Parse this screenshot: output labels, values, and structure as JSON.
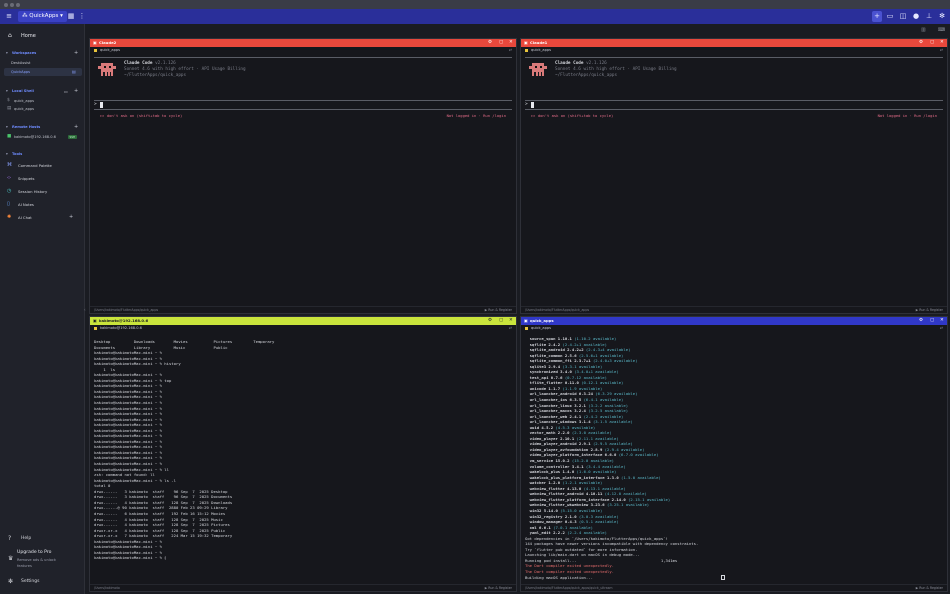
{
  "topbar": {
    "workspace_label": "QuickApps",
    "menu_icon": "hamburger-icon"
  },
  "sidebar": {
    "home_label": "Home",
    "workspaces_label": "Workspaces",
    "workspaces": [
      "DeskAssist",
      "QuickApps"
    ],
    "local_shell_label": "Local Shell",
    "local_shell": [
      "quick_apps",
      "quick_apps"
    ],
    "remote_hosts_label": "Remote Hosts",
    "remote_host": "kakimoto@192.168.0.6",
    "remote_badge": "SSH",
    "tools_label": "Tools",
    "tools": [
      "Command Palette",
      "Snippets",
      "Session History",
      "AI Notes",
      "AI Chat"
    ],
    "help_label": "Help",
    "upgrade_title": "Upgrade to Pro",
    "upgrade_sub1": "Remove ads & unlock",
    "upgrade_sub2": "features",
    "settings_label": "Settings"
  },
  "panes": {
    "tl": {
      "title": "Claude2",
      "chip": "quick_apps",
      "cc_title": "Claude Code",
      "cc_version": "v2.1.126",
      "cc_model": "Sonnet 4.6 with high effort · API Usage Billing",
      "cc_path": "~/FlutterApps/quick_apps",
      "prompt_char": ">",
      "hint": "▸▸ don't ask on (shift+tab to cycle)",
      "login": "Not logged in · Run /login",
      "footer_path": "/Users/kakimoto/FlutterApps/quick_apps",
      "footer_action": "▶ Run & Register"
    },
    "tr": {
      "title": "Claude1",
      "chip": "quick_apps",
      "cc_title": "Claude Code",
      "cc_version": "v2.1.126",
      "cc_model": "Sonnet 4.6 with high effort · API Usage Billing",
      "cc_path": "~/FlutterApps/quick_apps",
      "prompt_char": ">",
      "hint": "▸▸ don't ask on (shift+tab to cycle)",
      "login": "Not logged in · Run /login",
      "footer_path": "/Users/kakimoto/FlutterApps/quick_apps",
      "footer_action": "▶ Run & Register"
    },
    "bl": {
      "title": "kakimoto@192.168.0.6",
      "chip": "kakimoto@192.168.0.6",
      "footer_path": "/Users/kakimoto",
      "footer_action": "▶ Run & Register",
      "lines": [
        "Desktop          Downloads        Movies           Pictures         Temporary",
        "Documents        Library          Music            Public",
        "kakimoto@kakimotoMac-mini ~ %",
        "kakimoto@kakimotoMac-mini ~ %",
        "kakimoto@kakimotoMac-mini ~ % history",
        "    1  ls",
        "kakimoto@kakimotoMac-mini ~ %",
        "kakimoto@kakimotoMac-mini ~ % top",
        "kakimoto@kakimotoMac-mini ~ %",
        "kakimoto@kakimotoMac-mini ~ %",
        "kakimoto@kakimotoMac-mini ~ %",
        "kakimoto@kakimotoMac-mini ~ %",
        "kakimoto@kakimotoMac-mini ~ %",
        "kakimoto@kakimotoMac-mini ~ %",
        "kakimoto@kakimotoMac-mini ~ %",
        "kakimoto@kakimotoMac-mini ~ %",
        "kakimoto@kakimotoMac-mini ~ %",
        "kakimoto@kakimotoMac-mini ~ %",
        "kakimoto@kakimotoMac-mini ~ %",
        "kakimoto@kakimotoMac-mini ~ %",
        "kakimoto@kakimotoMac-mini ~ %",
        "kakimoto@kakimotoMac-mini ~ %",
        "kakimoto@kakimotoMac-mini ~ %",
        "kakimoto@kakimotoMac-mini ~ % ll",
        "zsh: command not found: ll",
        "kakimoto@kakimotoMac-mini ~ % ls -l",
        "total 0",
        "drwx------   3 kakimoto  staff    96 Sep  7  2025 Desktop",
        "drwx------   3 kakimoto  staff    96 Sep  7  2025 Documents",
        "drwx------   4 kakimoto  staff   128 Sep  7  2025 Downloads",
        "drwx------@ 90 kakimoto  staff  2880 Feb 23 09:29 Library",
        "drwx------   6 kakimoto  staff   192 Feb 16 15:12 Movies",
        "drwx------   4 kakimoto  staff   128 Sep  7  2025 Music",
        "drwx------   4 kakimoto  staff   128 Sep  7  2025 Pictures",
        "drwxr-xr-x   4 kakimoto  staff   128 Sep  7  2025 Public",
        "drwxr-xr-x   7 kakimoto  staff   224 Mar 15 19:32 Temporary",
        "kakimoto@kakimotoMac-mini ~ %",
        "kakimoto@kakimotoMac-mini ~ %",
        "kakimoto@kakimotoMac-mini ~ %",
        "kakimoto@kakimotoMac-mini ~ % ▯"
      ]
    },
    "br": {
      "title": "quick_apps",
      "chip": "quick_apps",
      "footer_path": "/Users/kakimoto/FlutterApps/quick_apps/quick_ultrasm",
      "footer_action": "▶ Run & Register",
      "packages": [
        [
          "source_span",
          "1.10.1",
          "(1.10.2 available)"
        ],
        [
          "sqflite",
          "2.4.2",
          "(2.4.2+1 available)"
        ],
        [
          "sqflite_android",
          "2.4.2+2",
          "(2.4.3+4 available)"
        ],
        [
          "sqflite_common",
          "2.5.6",
          "(2.5.6+1 available)"
        ],
        [
          "sqflite_common_ffi",
          "2.3.7+1",
          "(2.4.0+3 available)"
        ],
        [
          "sqlite3",
          "2.9.4",
          "(3.3.1 available)"
        ],
        [
          "synchronized",
          "3.4.0",
          "(3.4.0+1 available)"
        ],
        [
          "test_api",
          "0.7.6",
          "(0.7.12 available)"
        ],
        [
          "tflite_flutter",
          "0.11.0",
          "(0.12.1 available)"
        ],
        [
          "unicode",
          "1.1.7",
          "(1.1.9 available)"
        ],
        [
          "url_launcher_android",
          "6.3.24",
          "(6.3.29 available)"
        ],
        [
          "url_launcher_ios",
          "6.3.5",
          "(6.4.1 available)"
        ],
        [
          "url_launcher_linux",
          "3.2.1",
          "(3.2.2 available)"
        ],
        [
          "url_launcher_macos",
          "3.2.4",
          "(3.2.5 available)"
        ],
        [
          "url_launcher_web",
          "2.4.1",
          "(2.4.2 available)"
        ],
        [
          "url_launcher_windows",
          "3.1.4",
          "(3.1.5 available)"
        ],
        [
          "uuid",
          "4.5.2",
          "(4.5.3 available)"
        ],
        [
          "vector_math",
          "2.2.0",
          "(2.3.0 available)"
        ],
        [
          "video_player",
          "2.10.1",
          "(2.11.1 available)"
        ],
        [
          "video_player_android",
          "2.9.1",
          "(2.9.5 available)"
        ],
        [
          "video_player_avfoundation",
          "2.8.9",
          "(2.9.4 available)"
        ],
        [
          "video_player_platform_interface",
          "6.6.0",
          "(6.7.0 available)"
        ],
        [
          "vm_service",
          "15.0.2",
          "(15.2.0 available)"
        ],
        [
          "volume_controller",
          "3.4.1",
          "(3.4.4 available)"
        ],
        [
          "wakelock_plus",
          "1.4.0",
          "(1.6.0 available)"
        ],
        [
          "wakelock_plus_platform_interface",
          "1.3.0",
          "(1.5.0 available)"
        ],
        [
          "watcher",
          "1.2.0",
          "(1.2.1 available)"
        ],
        [
          "webview_flutter",
          "4.13.0",
          "(4.13.1 available)"
        ],
        [
          "webview_flutter_android",
          "4.10.11",
          "(4.12.0 available)"
        ],
        [
          "webview_flutter_platform_interface",
          "2.14.0",
          "(2.15.1 available)"
        ],
        [
          "webview_flutter_wkwebview",
          "3.23.6",
          "(3.25.1 available)"
        ],
        [
          "win32",
          "5.14.0",
          "(5.15.0 available)"
        ],
        [
          "win32_registry",
          "2.1.0",
          "(3.0.3 available)"
        ],
        [
          "window_manager",
          "0.4.3",
          "(0.5.1 available)"
        ],
        [
          "xml",
          "6.6.1",
          "(7.0.1 available)"
        ],
        [
          "yaml_edit",
          "2.2.2",
          "(2.2.4 available)"
        ]
      ],
      "tail": [
        "Got dependencies in `/Users/kakimoto/FlutterApps/quick_apps`!",
        "144 packages have newer versions incompatible with dependency constraints.",
        "Try `flutter pub outdated` for more information.",
        "Launching lib/main.dart on macOS in debug mode...",
        "Running pod install...                                    1,341ms"
      ],
      "errors": [
        "The Dart compiler exited unexpectedly.",
        "The Dart compiler exited unexpectedly."
      ],
      "last": "Building macOS application..."
    }
  }
}
